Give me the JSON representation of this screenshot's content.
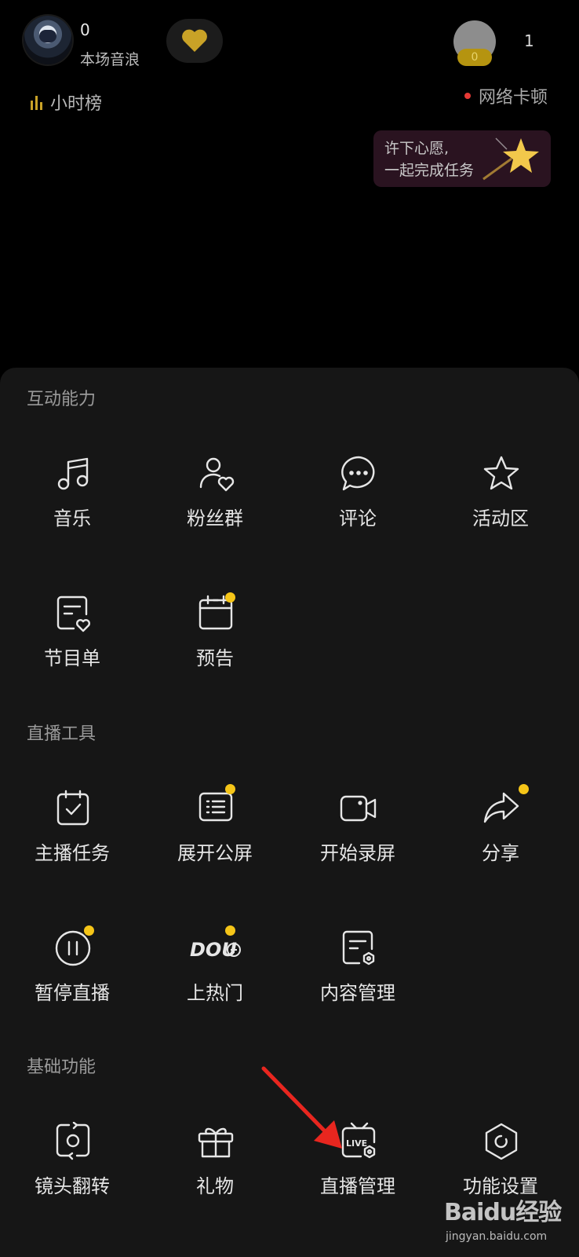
{
  "top": {
    "sound_wave_count": "0",
    "sound_wave_label": "本场音浪",
    "viewer_badge": "0",
    "viewer_count": "1",
    "rank_label": "小时榜",
    "network_status": "网络卡顿",
    "wish": {
      "line1": "许下心愿,",
      "line2": "一起完成任务"
    }
  },
  "sections": {
    "interactive": {
      "title": "互动能力",
      "items": [
        "音乐",
        "粉丝群",
        "评论",
        "活动区",
        "节目单",
        "预告"
      ]
    },
    "tools": {
      "title": "直播工具",
      "items": [
        "主播任务",
        "展开公屏",
        "开始录屏",
        "分享",
        "暂停直播",
        "上热门",
        "内容管理"
      ]
    },
    "basic": {
      "title": "基础功能",
      "items": [
        "镜头翻转",
        "礼物",
        "直播管理",
        "功能设置"
      ]
    }
  },
  "watermark": {
    "brand": "Baidu经验",
    "site": "jingyan.baidu.com"
  },
  "colors": {
    "panel": "#161616",
    "badge_dot": "#f5c518",
    "arrow": "#e8261f"
  }
}
